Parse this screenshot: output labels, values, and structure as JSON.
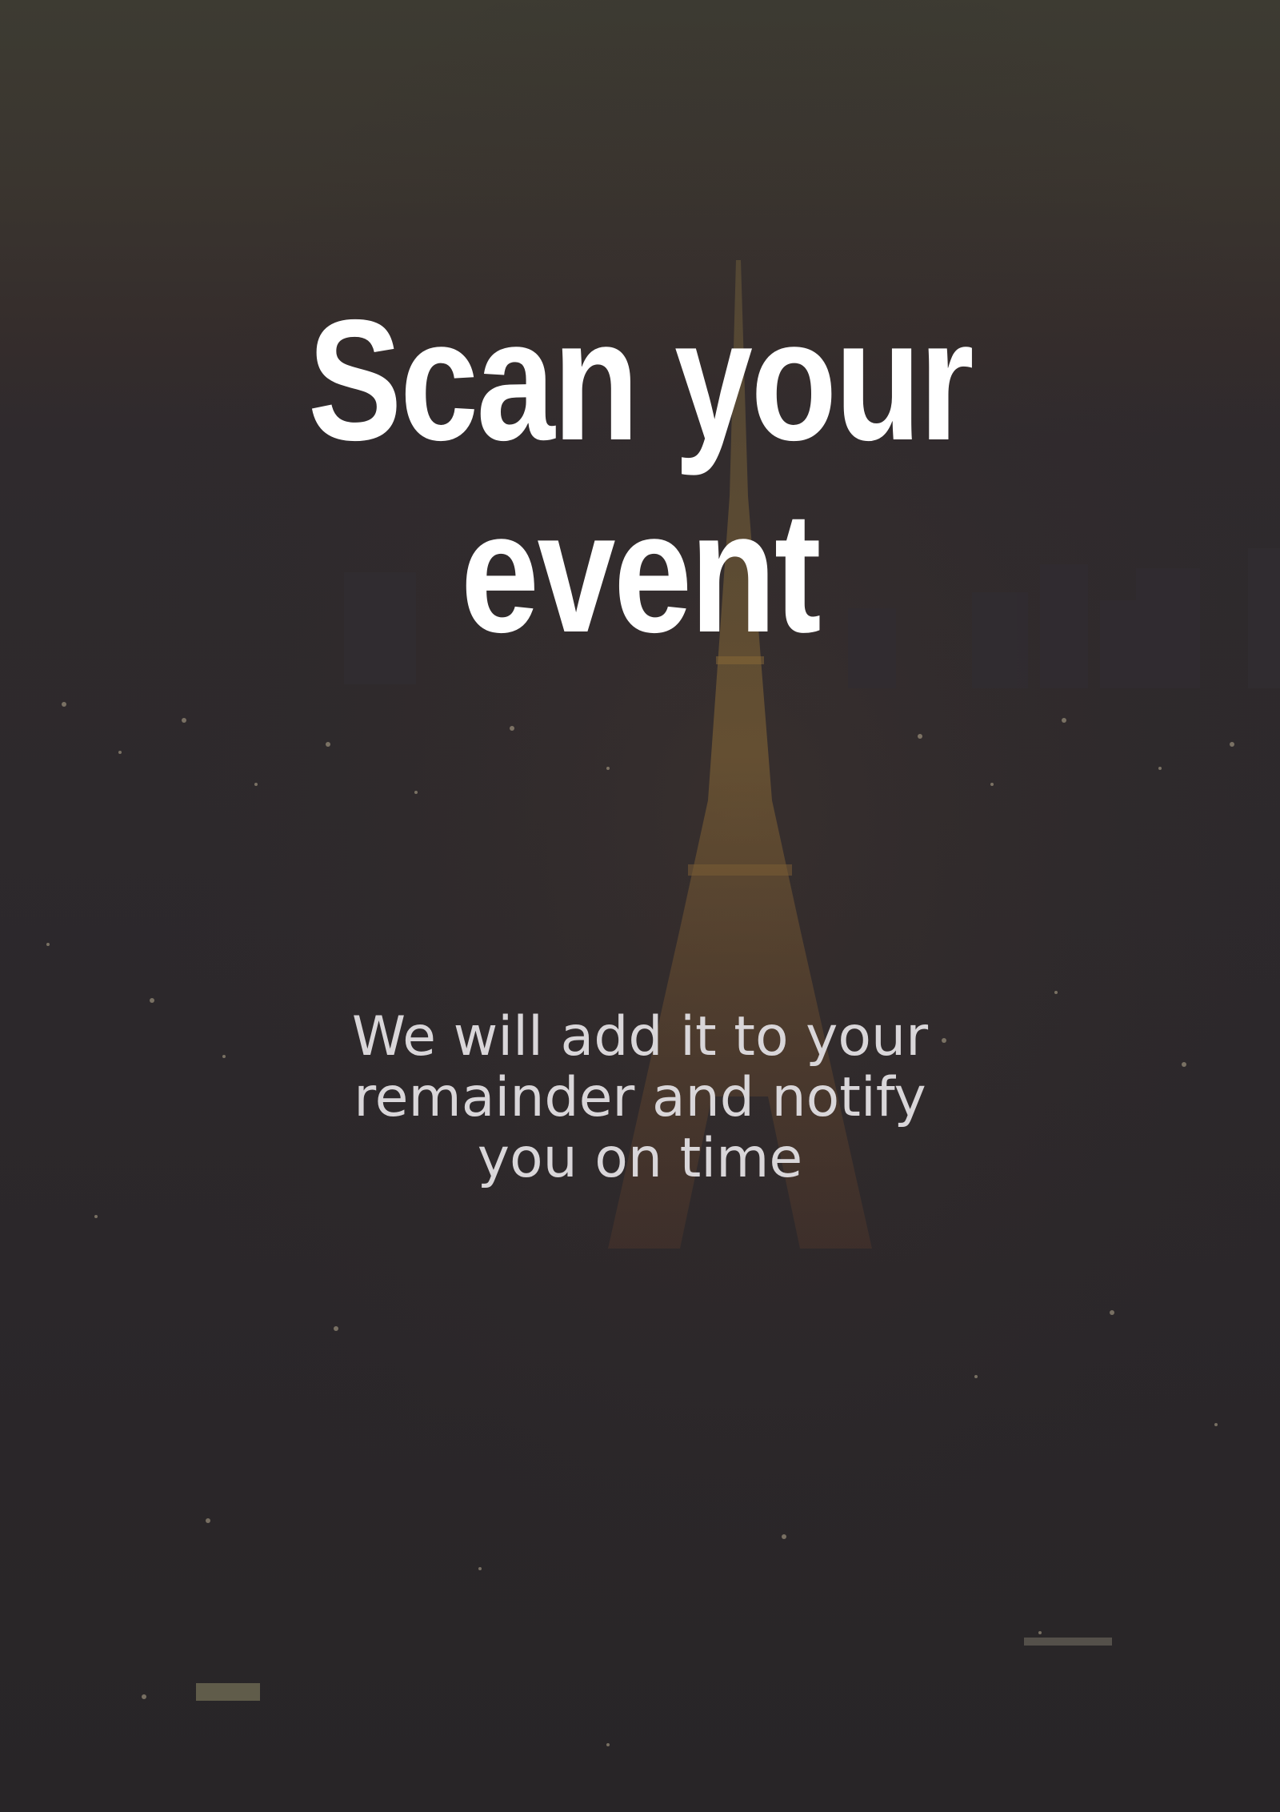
{
  "onboarding": {
    "title": "Scan your\nevent",
    "description": "We will add it to your\nremainder and notify\nyou on time"
  },
  "background": {
    "image": "night-city-eiffel-tower-icon",
    "overlay_color": "#2b272a",
    "sky_color": "#3d3b32",
    "light_color": "#d4a24a"
  },
  "colors": {
    "title": "#ffffff",
    "description": "#d9d6d9"
  }
}
